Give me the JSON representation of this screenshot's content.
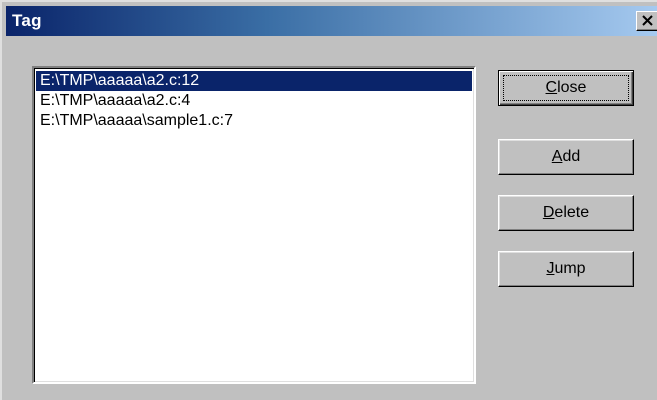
{
  "window": {
    "title": "Tag",
    "close_icon": "close-icon"
  },
  "list": {
    "items": [
      {
        "label": "E:\\TMP\\aaaaa\\a2.c:12",
        "selected": true
      },
      {
        "label": "E:\\TMP\\aaaaa\\a2.c:4",
        "selected": false
      },
      {
        "label": "E:\\TMP\\aaaaa\\sample1.c:7",
        "selected": false
      }
    ]
  },
  "buttons": {
    "close": {
      "mnemonic": "C",
      "rest": "lose"
    },
    "add": {
      "mnemonic": "A",
      "rest": "dd"
    },
    "delete": {
      "mnemonic": "D",
      "rest": "elete"
    },
    "jump": {
      "mnemonic": "J",
      "rest": "ump"
    }
  },
  "colors": {
    "selection": "#0a246a",
    "title_start": "#0a246a",
    "title_end": "#a6caf0",
    "face": "#c0c0c0"
  }
}
